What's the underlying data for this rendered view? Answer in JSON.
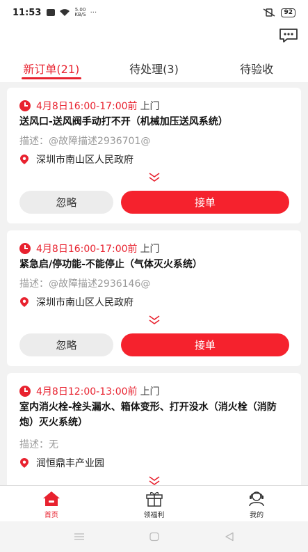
{
  "status_bar": {
    "time": "11:53",
    "speed_top": "5.00",
    "speed_bottom": "KB/S",
    "more": "···",
    "battery": "92"
  },
  "tabs": [
    {
      "label": "新订单(21)",
      "active": true
    },
    {
      "label": "待处理(3)",
      "active": false
    },
    {
      "label": "待验收",
      "active": false
    }
  ],
  "orders": [
    {
      "time": "4月8日16:00-17:00前",
      "time_suffix": "上门",
      "title": "送风口-送风阀手动打不开（机械加压送风系统）",
      "desc": "描述：@故障描述2936701@",
      "address": "深圳市南山区人民政府",
      "ignore_label": "忽略",
      "accept_label": "接单"
    },
    {
      "time": "4月8日16:00-17:00前",
      "time_suffix": "上门",
      "title": "紧急启/停功能-不能停止（气体灭火系统）",
      "desc": "描述：@故障描述2936146@",
      "address": "深圳市南山区人民政府",
      "ignore_label": "忽略",
      "accept_label": "接单"
    },
    {
      "time": "4月8日12:00-13:00前",
      "time_suffix": "上门",
      "title": "室内消火栓-栓头漏水、箱体变形、打开没水（消火栓（消防炮）灭火系统）",
      "desc": "描述：无",
      "address": "润恒鼎丰产业园"
    }
  ],
  "bottom_nav": [
    {
      "label": "首页",
      "icon": "home-icon",
      "active": true
    },
    {
      "label": "领福利",
      "icon": "gift-icon",
      "active": false
    },
    {
      "label": "我的",
      "icon": "profile-icon",
      "active": false
    }
  ],
  "colors": {
    "accent": "#e8222f",
    "accept_button": "#f5222d",
    "background": "#f2f2f2"
  }
}
